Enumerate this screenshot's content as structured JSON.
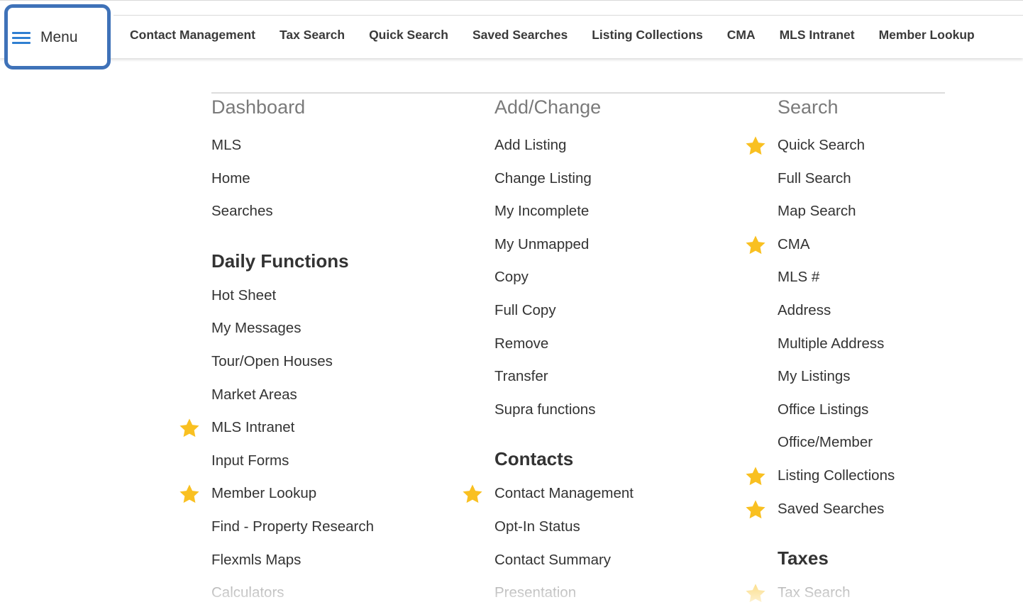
{
  "menu_button": {
    "label": "Menu",
    "icon": "hamburger-icon"
  },
  "nav": [
    "Contact Management",
    "Tax Search",
    "Quick Search",
    "Saved Searches",
    "Listing Collections",
    "CMA",
    "MLS Intranet",
    "Member Lookup"
  ],
  "colors": {
    "accent_blue": "#3f72b8",
    "hamburger": "#2f7fd1",
    "star": "#f9c021"
  },
  "dashboard": {
    "title": "Dashboard",
    "items": [
      {
        "label": "MLS",
        "starred": false
      },
      {
        "label": "Home",
        "starred": false
      },
      {
        "label": "Searches",
        "starred": false
      }
    ],
    "daily_functions": {
      "title": "Daily Functions",
      "items": [
        {
          "label": "Hot Sheet",
          "starred": false
        },
        {
          "label": "My Messages",
          "starred": false
        },
        {
          "label": "Tour/Open Houses",
          "starred": false
        },
        {
          "label": "Market Areas",
          "starred": false
        },
        {
          "label": "MLS Intranet",
          "starred": true
        },
        {
          "label": "Input Forms",
          "starred": false
        },
        {
          "label": "Member Lookup",
          "starred": true
        },
        {
          "label": "Find - Property Research",
          "starred": false
        },
        {
          "label": "Flexmls Maps",
          "starred": false
        },
        {
          "label": "Calculators",
          "starred": false
        }
      ]
    }
  },
  "add_change": {
    "title": "Add/Change",
    "items": [
      {
        "label": "Add Listing",
        "starred": false
      },
      {
        "label": "Change Listing",
        "starred": false
      },
      {
        "label": "My Incomplete",
        "starred": false
      },
      {
        "label": "My Unmapped",
        "starred": false
      },
      {
        "label": "Copy",
        "starred": false
      },
      {
        "label": "Full Copy",
        "starred": false
      },
      {
        "label": "Remove",
        "starred": false
      },
      {
        "label": "Transfer",
        "starred": false
      },
      {
        "label": "Supra functions",
        "starred": false
      }
    ],
    "contacts": {
      "title": "Contacts",
      "items": [
        {
          "label": "Contact Management",
          "starred": true
        },
        {
          "label": "Opt-In Status",
          "starred": false
        },
        {
          "label": "Contact Summary",
          "starred": false
        },
        {
          "label": "Presentation",
          "starred": false
        }
      ]
    }
  },
  "search": {
    "title": "Search",
    "items": [
      {
        "label": "Quick Search",
        "starred": true
      },
      {
        "label": "Full Search",
        "starred": false
      },
      {
        "label": "Map Search",
        "starred": false
      },
      {
        "label": "CMA",
        "starred": true
      },
      {
        "label": "MLS #",
        "starred": false
      },
      {
        "label": "Address",
        "starred": false
      },
      {
        "label": "Multiple Address",
        "starred": false
      },
      {
        "label": "My Listings",
        "starred": false
      },
      {
        "label": "Office Listings",
        "starred": false
      },
      {
        "label": "Office/Member",
        "starred": false
      },
      {
        "label": "Listing Collections",
        "starred": true
      },
      {
        "label": "Saved Searches",
        "starred": true
      }
    ],
    "taxes": {
      "title": "Taxes",
      "items": [
        {
          "label": "Tax Search",
          "starred": true
        }
      ]
    }
  }
}
